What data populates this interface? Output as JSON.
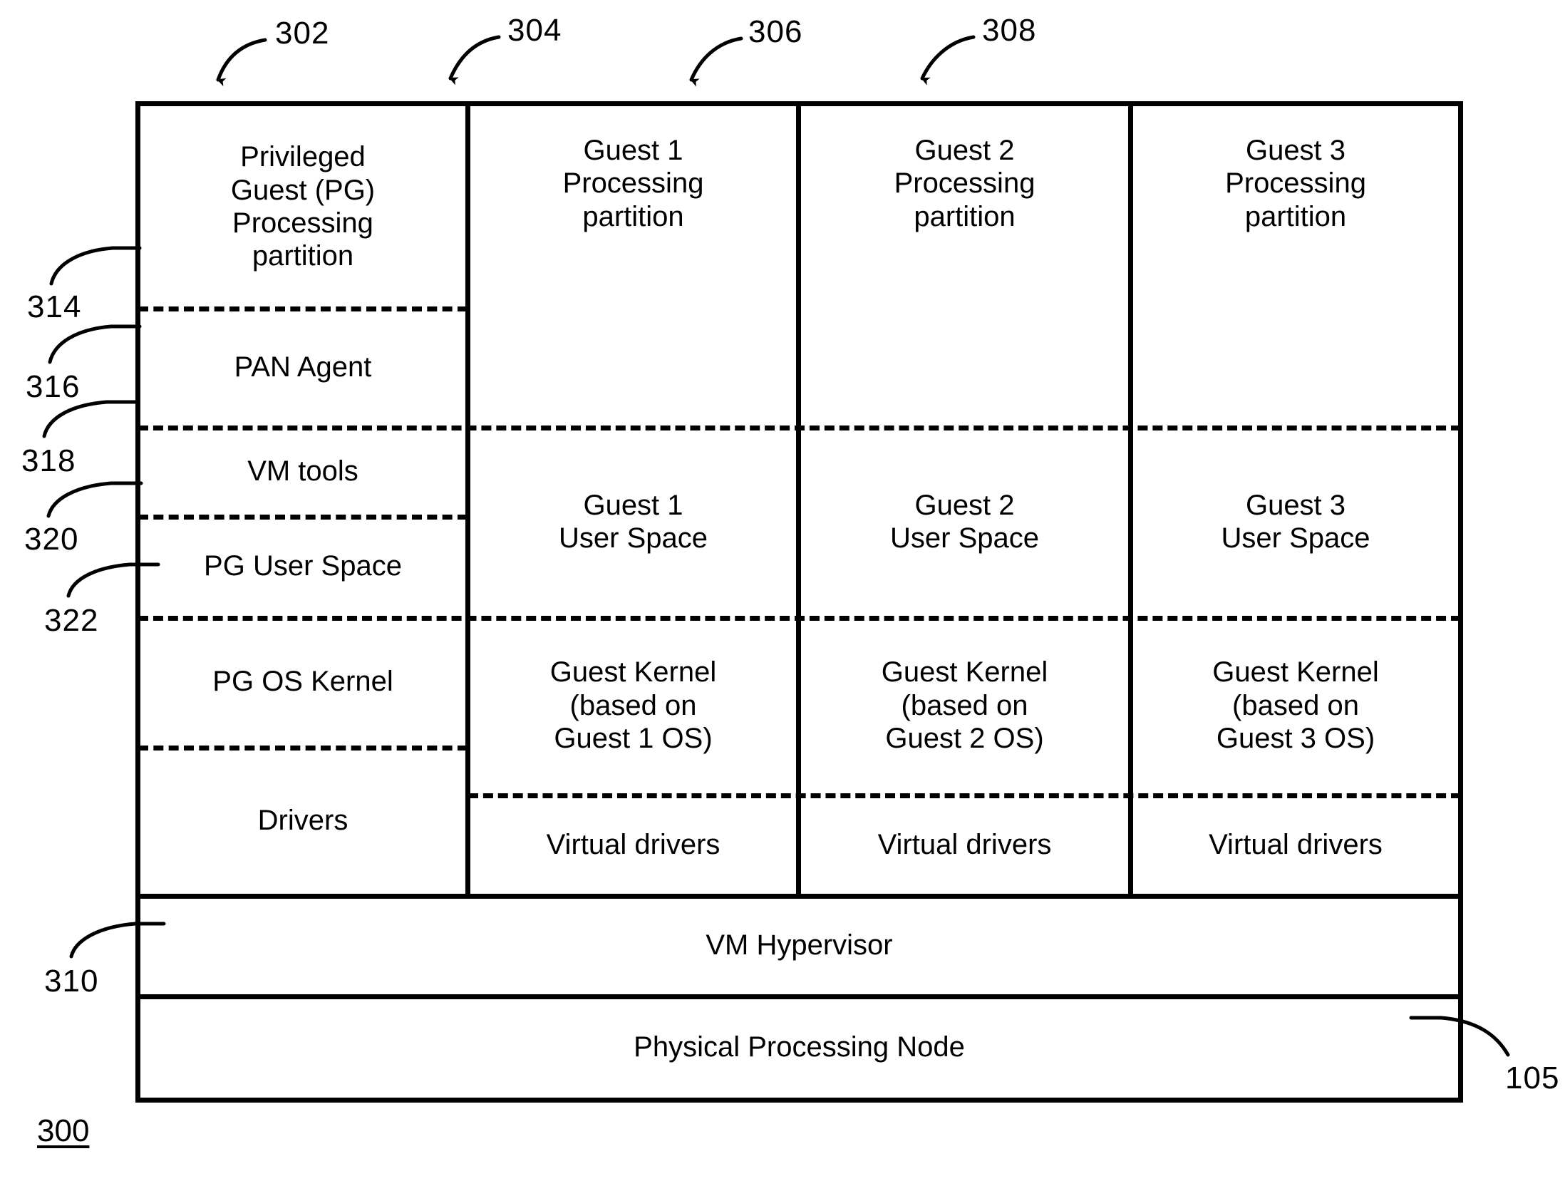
{
  "figure": {
    "figure_label": "300",
    "bottom_right_ref": "105"
  },
  "callouts": {
    "top": [
      {
        "ref": "302",
        "target": "privileged-guest-partition"
      },
      {
        "ref": "304",
        "target": "guest-1-partition"
      },
      {
        "ref": "306",
        "target": "guest-2-partition"
      },
      {
        "ref": "308",
        "target": "guest-3-partition"
      }
    ],
    "left": [
      {
        "ref": "314",
        "target": "pan-agent"
      },
      {
        "ref": "316",
        "target": "vm-tools"
      },
      {
        "ref": "318",
        "target": "pg-user-space"
      },
      {
        "ref": "320",
        "target": "pg-os-kernel"
      },
      {
        "ref": "322",
        "target": "drivers"
      },
      {
        "ref": "310",
        "target": "vm-hypervisor"
      }
    ]
  },
  "columns": {
    "privileged_guest": {
      "title": "Privileged\nGuest (PG)\nProcessing\npartition",
      "rows": {
        "pan_agent": "PAN Agent",
        "vm_tools": "VM tools",
        "pg_user_space": "PG User Space",
        "pg_os_kernel": "PG OS Kernel",
        "drivers": "Drivers"
      }
    },
    "guest_1": {
      "title": "Guest 1\nProcessing\npartition",
      "user_space": "Guest 1\nUser Space",
      "kernel": "Guest Kernel\n(based on\nGuest 1 OS)",
      "virtual_drivers": "Virtual drivers"
    },
    "guest_2": {
      "title": "Guest 2\nProcessing\npartition",
      "user_space": "Guest 2\nUser Space",
      "kernel": "Guest Kernel\n(based on\nGuest 2 OS)",
      "virtual_drivers": "Virtual drivers"
    },
    "guest_3": {
      "title": "Guest 3\nProcessing\npartition",
      "user_space": "Guest 3\nUser Space",
      "kernel": "Guest Kernel\n(based on\nGuest 3 OS)",
      "virtual_drivers": "Virtual drivers"
    }
  },
  "base_layers": {
    "hypervisor": "VM Hypervisor",
    "physical_node": "Physical Processing Node"
  }
}
